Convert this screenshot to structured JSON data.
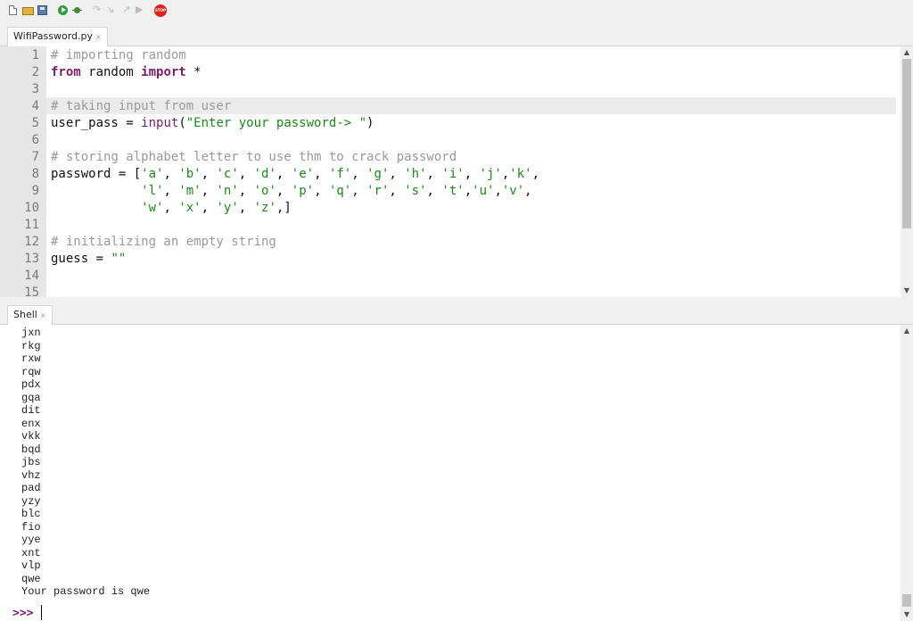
{
  "toolbar": {
    "buttons": [
      {
        "name": "new-file-icon",
        "enabled": true
      },
      {
        "name": "open-file-icon",
        "enabled": true
      },
      {
        "name": "save-file-icon",
        "enabled": true
      },
      {
        "name": "run-icon",
        "enabled": true
      },
      {
        "name": "debug-icon",
        "enabled": true
      },
      {
        "name": "step-over-icon",
        "enabled": false
      },
      {
        "name": "step-into-icon",
        "enabled": false
      },
      {
        "name": "step-out-icon",
        "enabled": false
      },
      {
        "name": "resume-icon",
        "enabled": false
      },
      {
        "name": "stop-icon",
        "enabled": true,
        "label": "STOP"
      }
    ]
  },
  "editor": {
    "tab": {
      "label": "WifiPassword.py",
      "close": "×"
    },
    "line_numbers": [
      "1",
      "2",
      "3",
      "4",
      "5",
      "6",
      "7",
      "8",
      "9",
      "10",
      "11",
      "12",
      "13",
      "14",
      "15"
    ],
    "current_line": 4,
    "lines": [
      [
        {
          "t": "# importing random",
          "c": "cmt"
        }
      ],
      [
        {
          "t": "from",
          "c": "kw"
        },
        {
          "t": " random "
        },
        {
          "t": "import",
          "c": "kw"
        },
        {
          "t": " *"
        }
      ],
      [],
      [
        {
          "t": "# taking input from user",
          "c": "cmt"
        }
      ],
      [
        {
          "t": "user_pass = "
        },
        {
          "t": "input",
          "c": "bi"
        },
        {
          "t": "("
        },
        {
          "t": "\"Enter your password-> \"",
          "c": "str"
        },
        {
          "t": ")"
        }
      ],
      [],
      [
        {
          "t": "# storing alphabet letter to use thm to crack password",
          "c": "cmt"
        }
      ],
      [
        {
          "t": "password = ["
        },
        {
          "t": "'a'",
          "c": "str"
        },
        {
          "t": ", "
        },
        {
          "t": "'b'",
          "c": "str"
        },
        {
          "t": ", "
        },
        {
          "t": "'c'",
          "c": "str"
        },
        {
          "t": ", "
        },
        {
          "t": "'d'",
          "c": "str"
        },
        {
          "t": ", "
        },
        {
          "t": "'e'",
          "c": "str"
        },
        {
          "t": ", "
        },
        {
          "t": "'f'",
          "c": "str"
        },
        {
          "t": ", "
        },
        {
          "t": "'g'",
          "c": "str"
        },
        {
          "t": ", "
        },
        {
          "t": "'h'",
          "c": "str"
        },
        {
          "t": ", "
        },
        {
          "t": "'i'",
          "c": "str"
        },
        {
          "t": ", "
        },
        {
          "t": "'j'",
          "c": "str"
        },
        {
          "t": ","
        },
        {
          "t": "'k'",
          "c": "str"
        },
        {
          "t": ","
        }
      ],
      [
        {
          "t": "            "
        },
        {
          "t": "'l'",
          "c": "str"
        },
        {
          "t": ", "
        },
        {
          "t": "'m'",
          "c": "str"
        },
        {
          "t": ", "
        },
        {
          "t": "'n'",
          "c": "str"
        },
        {
          "t": ", "
        },
        {
          "t": "'o'",
          "c": "str"
        },
        {
          "t": ", "
        },
        {
          "t": "'p'",
          "c": "str"
        },
        {
          "t": ", "
        },
        {
          "t": "'q'",
          "c": "str"
        },
        {
          "t": ", "
        },
        {
          "t": "'r'",
          "c": "str"
        },
        {
          "t": ", "
        },
        {
          "t": "'s'",
          "c": "str"
        },
        {
          "t": ", "
        },
        {
          "t": "'t'",
          "c": "str"
        },
        {
          "t": ","
        },
        {
          "t": "'u'",
          "c": "str"
        },
        {
          "t": ","
        },
        {
          "t": "'v'",
          "c": "str"
        },
        {
          "t": ","
        }
      ],
      [
        {
          "t": "            "
        },
        {
          "t": "'w'",
          "c": "str"
        },
        {
          "t": ", "
        },
        {
          "t": "'x'",
          "c": "str"
        },
        {
          "t": ", "
        },
        {
          "t": "'y'",
          "c": "str"
        },
        {
          "t": ", "
        },
        {
          "t": "'z'",
          "c": "str"
        },
        {
          "t": ",]"
        }
      ],
      [],
      [
        {
          "t": "# initializing an empty string",
          "c": "cmt"
        }
      ],
      [
        {
          "t": "guess = "
        },
        {
          "t": "\"\"",
          "c": "str"
        }
      ],
      [],
      []
    ]
  },
  "shell": {
    "tab": {
      "label": "Shell",
      "close": "×"
    },
    "output": [
      "jxn",
      "rkg",
      "rxw",
      "rqw",
      "pdx",
      "gqa",
      "dit",
      "enx",
      "vkk",
      "bqd",
      "jbs",
      "vhz",
      "pad",
      "yzy",
      "blc",
      "fio",
      "yye",
      "xnt",
      "vlp",
      "qwe",
      "Your password is qwe"
    ],
    "prompt": ">>>"
  }
}
